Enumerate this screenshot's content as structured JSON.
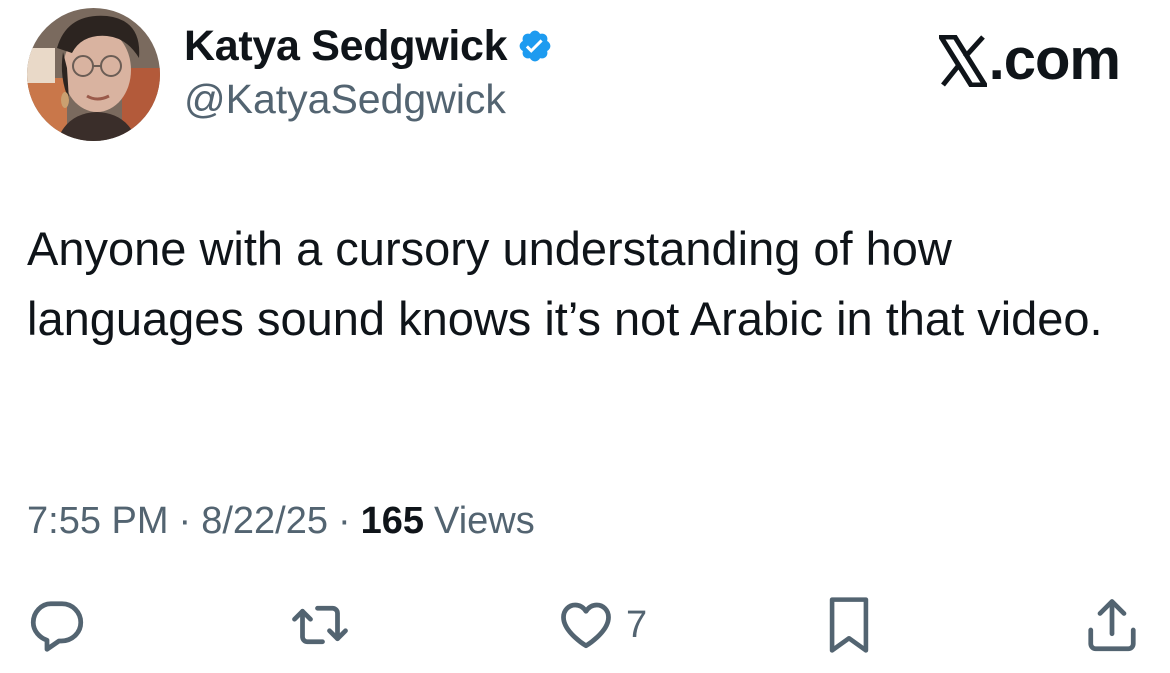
{
  "author": {
    "name": "Katya Sedgwick",
    "handle": "@KatyaSedgwick",
    "verified": true,
    "verified_color": "#1d9bf0"
  },
  "brand": {
    "label": ".com",
    "icon": "x-logo-icon"
  },
  "tweet": {
    "text": "Anyone with a cursory understanding of how languages sound knows it’s not Arabic in that video."
  },
  "meta": {
    "time": "7:55 PM",
    "separator": "·",
    "date": "8/22/25",
    "views_count": "165",
    "views_label": "Views"
  },
  "actions": {
    "reply": {
      "icon": "reply-icon"
    },
    "repost": {
      "icon": "repost-icon"
    },
    "like": {
      "icon": "heart-icon",
      "count": "7"
    },
    "bookmark": {
      "icon": "bookmark-icon"
    },
    "share": {
      "icon": "share-icon"
    }
  },
  "colors": {
    "text_primary": "#0f1419",
    "text_secondary": "#536471",
    "background": "#ffffff"
  }
}
